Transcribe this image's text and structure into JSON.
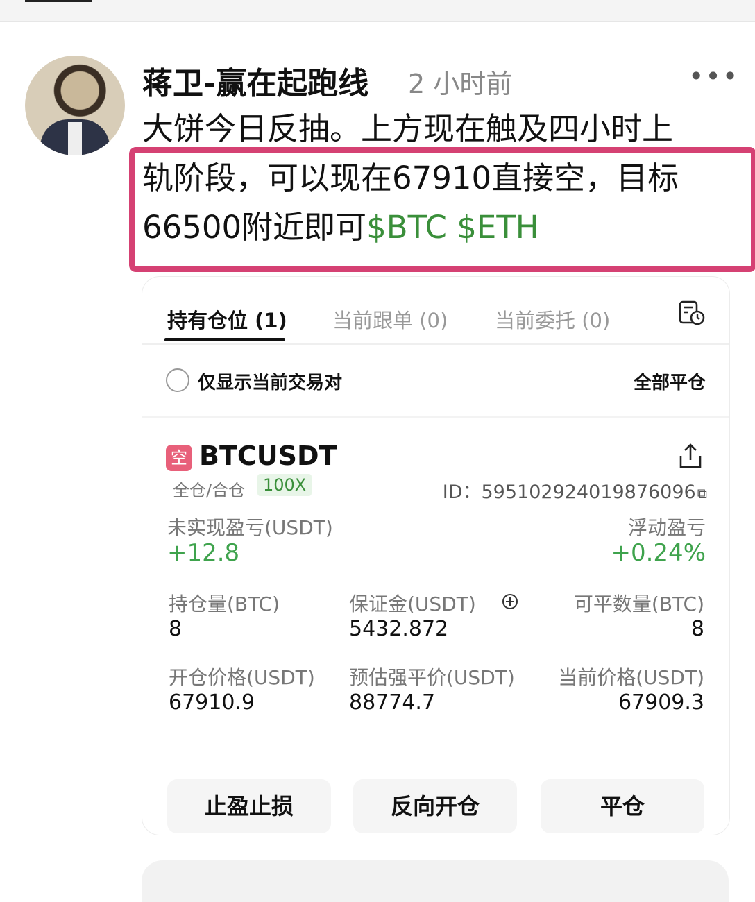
{
  "post": {
    "author": "蒋卫-赢在起跑线",
    "time": "2 小时前",
    "more": "•••",
    "text_line1": "大饼今日反抽。上方现在触及四小时上",
    "text_line2": "轨阶段，可以现在67910直接空，目标",
    "text_line3": "66500附近即可",
    "tags": [
      "$BTC",
      "$ETH"
    ]
  },
  "tabs": [
    {
      "label": "持有仓位 (1)",
      "active": true
    },
    {
      "label": "当前跟单 (0)",
      "active": false
    },
    {
      "label": "当前委托 (0)",
      "active": false
    }
  ],
  "filter": {
    "label": "仅显示当前交易对",
    "close_all": "全部平仓"
  },
  "position": {
    "side": "空",
    "symbol": "BTCUSDT",
    "margin_mode": "全仓/合仓",
    "leverage": "100X",
    "id": "ID：595102924019876096",
    "unrealized_label": "未实现盈亏(USDT)",
    "unrealized_value": "+12.8",
    "floating_label": "浮动盈亏",
    "floating_value": "+0.24%",
    "size_label": "持仓量(BTC)",
    "size_value": "8",
    "margin_label": "保证金(USDT)",
    "margin_value": "5432.872",
    "closable_label": "可平数量(BTC)",
    "closable_value": "8",
    "entry_label": "开仓价格(USDT)",
    "entry_value": "67910.9",
    "liq_label": "预估强平价(USDT)",
    "liq_value": "88774.7",
    "mark_label": "当前价格(USDT)",
    "mark_value": "67909.3"
  },
  "buttons": {
    "tpsl": "止盈止损",
    "reverse": "反向开仓",
    "close": "平仓"
  },
  "colors": {
    "profit": "#3fa34d",
    "tag": "#3a8f3a",
    "highlight": "#d54173",
    "short_badge": "#e8607a"
  },
  "icons": [
    "more-icon",
    "history-icon",
    "share-icon",
    "copy-icon",
    "add-circle-icon"
  ]
}
